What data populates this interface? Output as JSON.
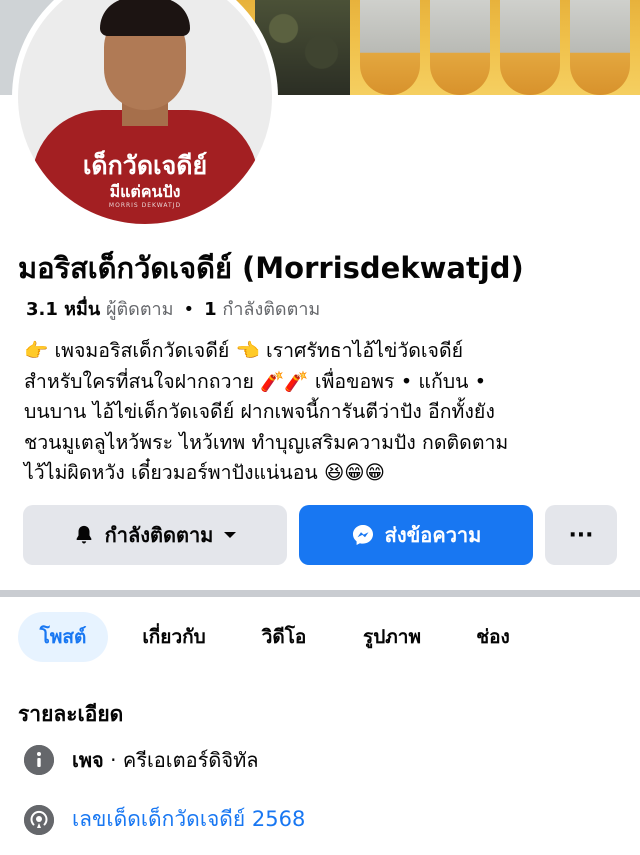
{
  "profile": {
    "name": "มอริสเด็กวัดเจดีย์ (Morrisdekwatjd)",
    "shirt_line1": "เด็กวัดเจดีย์",
    "shirt_line2": "มีแต่คนปัง",
    "shirt_line3": "MORRIS DEKWATJD"
  },
  "stats": {
    "followers_count": "3.1 หมื่น",
    "followers_label": "ผู้ติดตาม",
    "separator": "•",
    "following_count": "1",
    "following_label": "กำลังติดตาม"
  },
  "bio": {
    "line1": "👉 เพจมอริสเด็กวัดเจดีย์ 👈 เราศรัทธาไอ้ไข่วัดเจดีย์",
    "line2": "สำหรับใครที่สนใจฝากถวาย 🧨🧨 เพื่อขอพร • แก้บน •",
    "line3": "บนบาน ไอ้ไข่เด็กวัดเจดีย์ ฝากเพจนี้การันตีว่าปัง อีกทั้งยัง",
    "line4": "ชวนมูเตลูไหว้พระ ไหว้เทพ ทำบุญเสริมความปัง กดติดตาม",
    "line5": "ไว้ไม่ผิดหวัง เดี๋ยวมอร์พาปังแน่นอน 😆😁😁"
  },
  "actions": {
    "following_label": "กำลังติดตาม",
    "message_label": "ส่งข้อความ",
    "more_label": "···"
  },
  "tabs": [
    {
      "label": "โพสต์"
    },
    {
      "label": "เกี่ยวกับ"
    },
    {
      "label": "วิดีโอ"
    },
    {
      "label": "รูปภาพ"
    },
    {
      "label": "ช่อง"
    }
  ],
  "details": {
    "title": "รายละเอียด",
    "page_type_bold": "เพจ",
    "page_type_rest": " · ครีเอเตอร์ดิจิทัล",
    "channel_link": "เลขเด็ดเด็กวัดเจดีย์ 2568"
  },
  "colors": {
    "accent": "#1877f2",
    "button_gray": "#e4e6eb",
    "tab_active_bg": "#e7f3ff",
    "shirt_red": "#a31f22"
  },
  "icons": {
    "follow_button": "bell-icon",
    "follow_dropdown": "caret-down-icon",
    "message_button": "messenger-icon",
    "info_row": "info-icon",
    "channel_row": "broadcast-icon"
  }
}
